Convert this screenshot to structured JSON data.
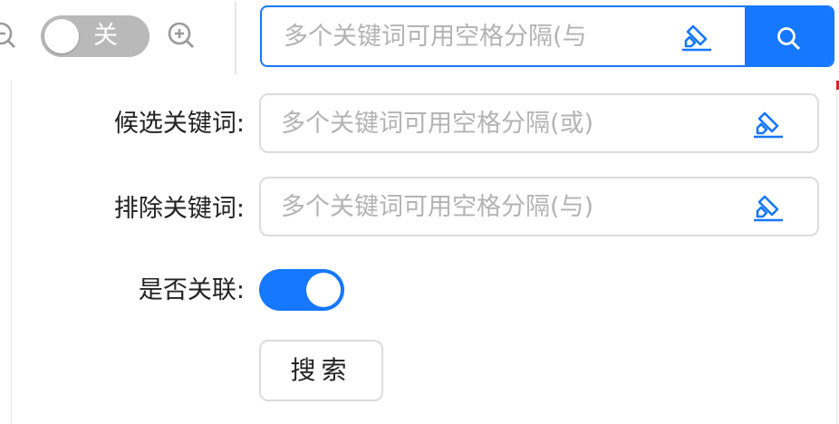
{
  "toolbar": {
    "zoom_out_icon": "zoom-out-icon",
    "zoom_in_icon": "zoom-in-icon",
    "toggle_label": "关",
    "toggle_on": false
  },
  "search": {
    "placeholder": "多个关键词可用空格分隔(与",
    "clear_icon": "highlighter-icon",
    "button_icon": "search-icon",
    "accent": "#1677ff"
  },
  "form": {
    "candidate_label": "候选关键词:",
    "candidate_placeholder": "多个关键词可用空格分隔(或)",
    "exclude_label": "排除关键词:",
    "exclude_placeholder": "多个关键词可用空格分隔(与)",
    "associate_label": "是否关联:",
    "associate_on": true,
    "submit_label": "搜索"
  }
}
